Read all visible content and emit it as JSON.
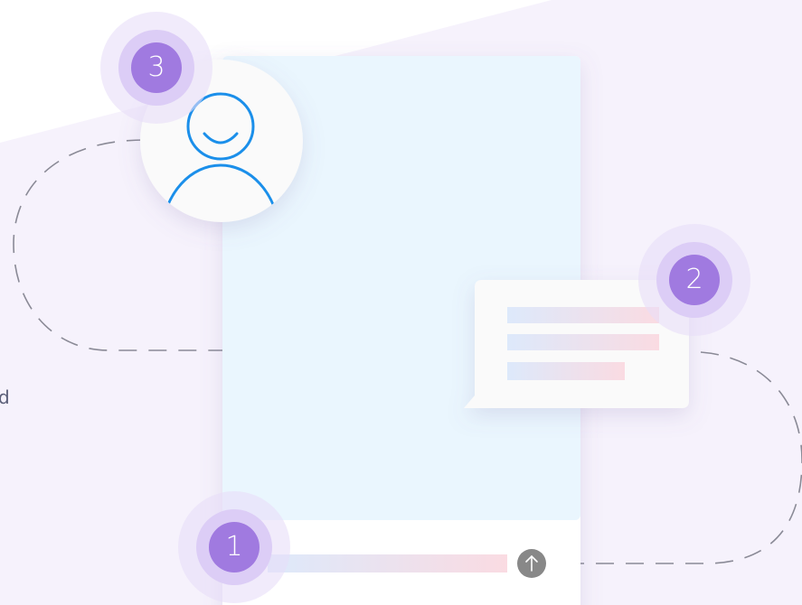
{
  "steps": [
    {
      "number": "1"
    },
    {
      "number": "2"
    },
    {
      "number": "3"
    }
  ],
  "edge_fragment": "d",
  "icons": {
    "send": "arrow-up-icon",
    "avatar": "user-icon"
  },
  "colors": {
    "background_band": "#f6f2fc",
    "phone_screen": "#eaf6fe",
    "step_badge": "#a07ae0",
    "step_halo": "#e8def8",
    "avatar_stroke": "#1b8fea",
    "path_dash": "#8a8a96",
    "send_button": "#888888"
  }
}
